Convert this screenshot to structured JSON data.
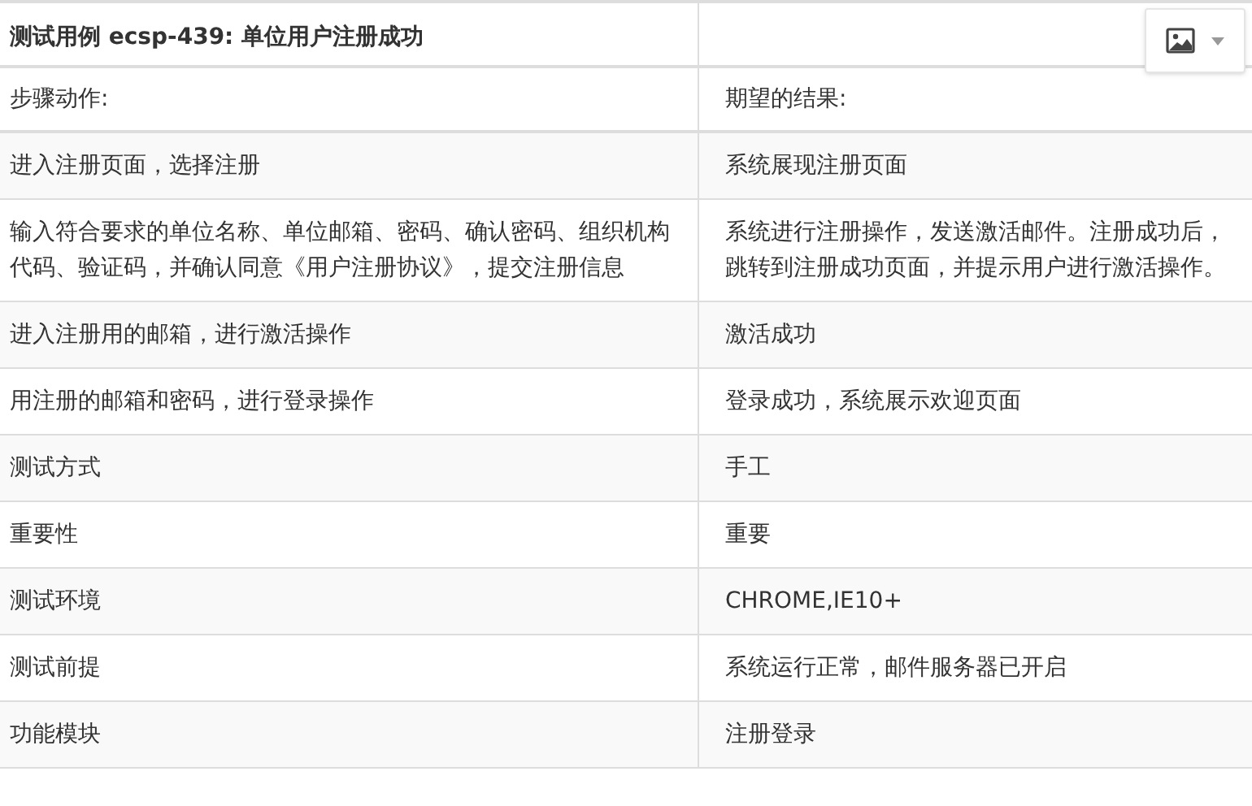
{
  "title": "测试用例 ecsp-439: 单位用户注册成功",
  "columns": [
    "步骤动作:",
    "期望的结果:"
  ],
  "steps": [
    {
      "action": "进入注册页面，选择注册",
      "expected": "系统展现注册页面"
    },
    {
      "action": "输入符合要求的单位名称、单位邮箱、密码、确认密码、组织机构代码、验证码，并确认同意《用户注册协议》，提交注册信息",
      "expected": "系统进行注册操作，发送激活邮件。注册成功后，跳转到注册成功页面，并提示用户进行激活操作。"
    },
    {
      "action": "进入注册用的邮箱，进行激活操作",
      "expected": "激活成功"
    },
    {
      "action": "用注册的邮箱和密码，进行登录操作",
      "expected": "登录成功，系统展示欢迎页面"
    }
  ],
  "properties": [
    {
      "label": "测试方式",
      "value": "手工"
    },
    {
      "label": "重要性",
      "value": "重要"
    },
    {
      "label": "测试环境",
      "value": "CHROME,IE10+"
    },
    {
      "label": "测试前提",
      "value": "系统运行正常，邮件服务器已开启"
    },
    {
      "label": "功能模块",
      "value": "注册登录"
    }
  ]
}
